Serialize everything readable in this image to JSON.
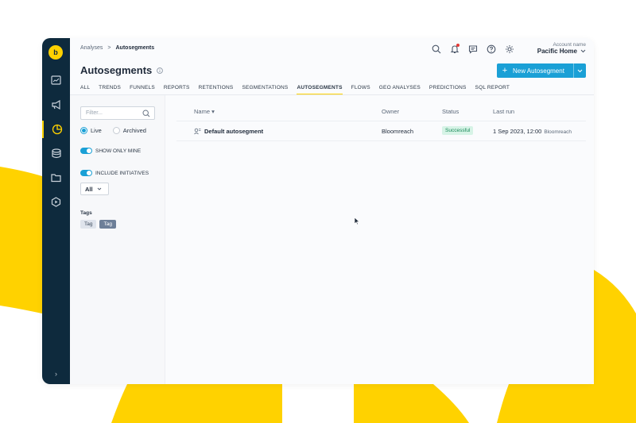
{
  "brand": {
    "accent": "#ffd200",
    "primary": "#1aa0d6",
    "rail": "#0e2a3d",
    "logo_letter": "b"
  },
  "breadcrumb": {
    "parent": "Analyses",
    "separator": ">",
    "current": "Autosegments"
  },
  "account": {
    "label": "Account name",
    "name": "Pacific Home"
  },
  "page": {
    "title": "Autosegments"
  },
  "new_button": {
    "plus": "+",
    "label": "New Autosegment",
    "caret": "⌄"
  },
  "tabs": [
    "ALL",
    "TRENDS",
    "FUNNELS",
    "REPORTS",
    "RETENTIONS",
    "SEGMENTATIONS",
    "AUTOSEGMENTS",
    "FLOWS",
    "GEO ANALYSES",
    "PREDICTIONS",
    "SQL REPORT"
  ],
  "active_tab": "AUTOSEGMENTS",
  "sidebar": {
    "filter_placeholder": "Filter...",
    "radio_live": "Live",
    "radio_archived": "Archived",
    "toggle_show_only_mine": "SHOW ONLY MINE",
    "toggle_include_initiatives": "INCLUDE INITIATIVES",
    "select_value": "All",
    "tags_label": "Tags",
    "tags": [
      "Tag",
      "Tag"
    ]
  },
  "table": {
    "headers": {
      "name": "Name",
      "owner": "Owner",
      "status": "Status",
      "last_run": "Last run"
    },
    "rows": [
      {
        "name": "Default autosegment",
        "owner": "Bloomreach",
        "status": "Successful",
        "last_run": "1 Sep 2023, 12:00",
        "last_run_by": "Bloomreach"
      }
    ]
  },
  "rail_icons": [
    "dashboard-icon",
    "megaphone-icon",
    "analytics-icon",
    "database-icon",
    "folder-icon",
    "play-hexagon-icon"
  ],
  "rail_expand": "›"
}
